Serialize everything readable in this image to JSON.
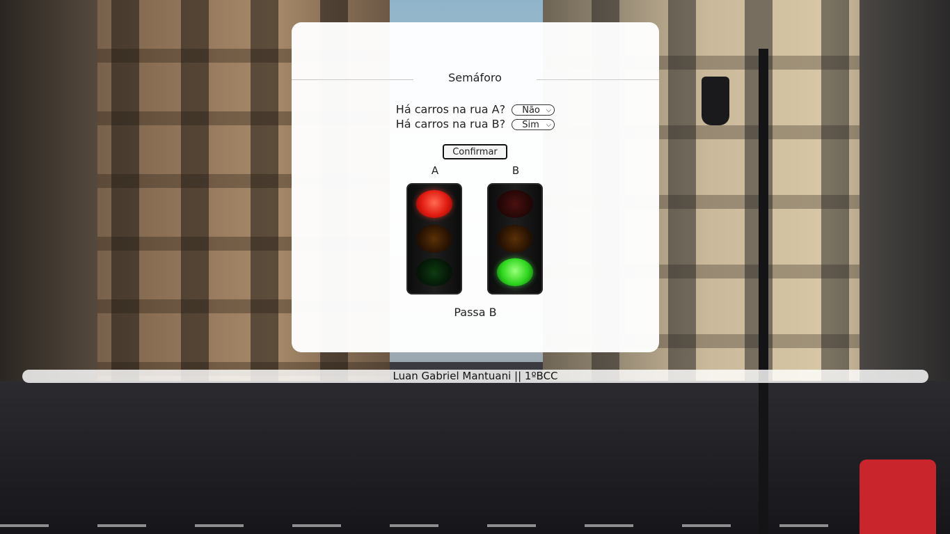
{
  "card": {
    "title": "Semáforo",
    "question_a": "Há carros na rua A?",
    "select_a_value": "Não",
    "question_b": "Há carros na rua B?",
    "select_b_value": "Sim",
    "confirm_label": "Confirmar",
    "signal_a_label": "A",
    "signal_b_label": "B",
    "signal_a_state": "red",
    "signal_b_state": "green",
    "result": "Passa B"
  },
  "footer": {
    "text": "Luan Gabriel Mantuani || 1ºBCC"
  },
  "icons": {
    "select_chevron": "chevron-down-icon"
  }
}
